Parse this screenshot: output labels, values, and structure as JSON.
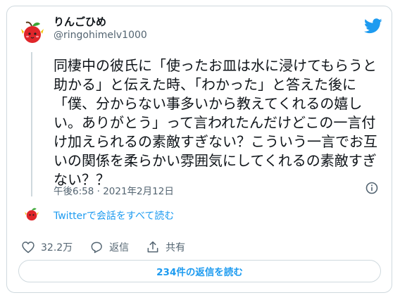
{
  "user": {
    "display_name": "りんごひめ",
    "handle": "@ringohimelv1000",
    "avatar_icon": "red-apple-character-icon"
  },
  "tweet": {
    "text": "同棲中の彼氏に「使ったお皿は水に浸けてもらうと\n助かる」と伝えた時、「わかった」と答えた後に\n「僕、分からない事多いから教えてくれるの嬉し\nい。ありがとう」って言われたんだけどこの一言付\nけ加えられるの素敵すぎない？こういう一言でお互\nいの関係を柔らかい雰囲気にしてくれるの素敵すぎ\nない？？",
    "timestamp": "午後6:58 · 2021年2月12日"
  },
  "conversation_link": "Twitterで会話をすべて読む",
  "actions": {
    "like_count": "32.2万",
    "reply_label": "返信",
    "share_label": "共有"
  },
  "replies_button": "234件の返信を読む",
  "colors": {
    "twitter_blue": "#1d9bf0",
    "text": "#0f1419",
    "secondary": "#536471",
    "border": "#cfd9de",
    "avatar_red": "#e0262a"
  },
  "icons": [
    "twitter-bird-icon",
    "info-icon",
    "heart-icon",
    "reply-bubble-icon",
    "share-icon"
  ]
}
